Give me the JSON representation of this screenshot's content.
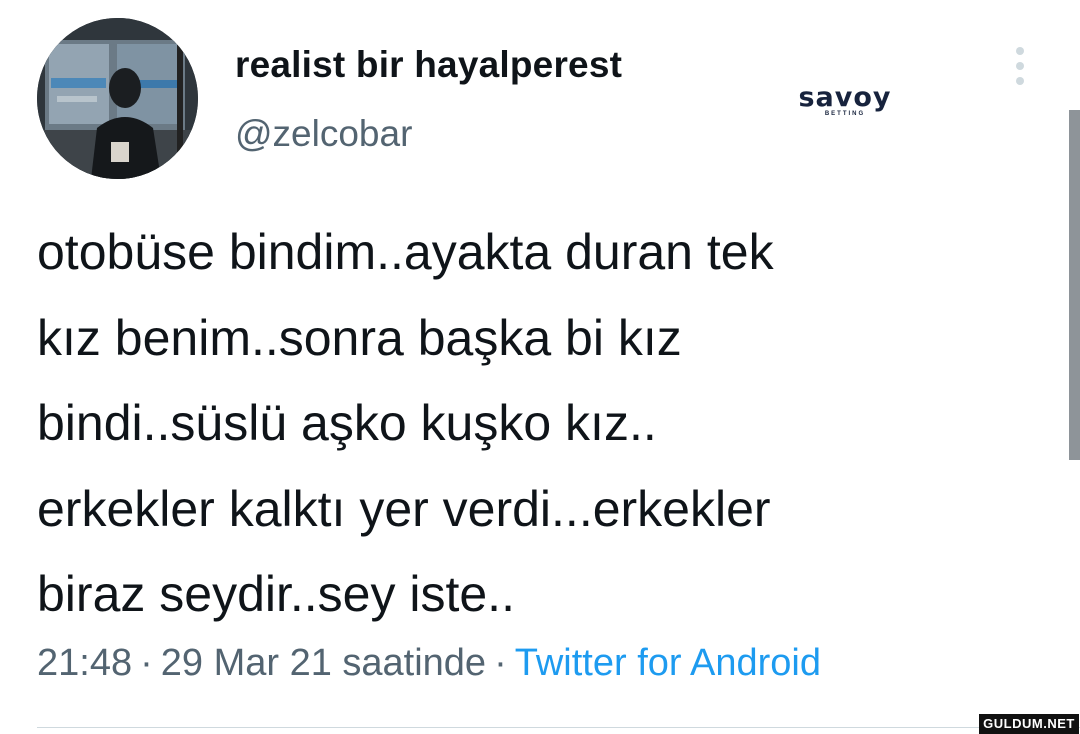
{
  "user": {
    "display_name": "realist bir hayalperest",
    "handle": "@zelcobar"
  },
  "logo": {
    "word": "savoy",
    "sub": "BETTING"
  },
  "tweet": {
    "lines": [
      "otobüse bindim..ayakta duran tek",
      "kız benim..sonra başka bi kız",
      "bindi..süslü aşko kuşko kız..",
      "erkekler kalktı yer verdi...erkekler",
      "biraz seydir..sey iste.."
    ]
  },
  "meta": {
    "time": "21:48",
    "separator": "·",
    "date": "29 Mar 21 saatinde",
    "source": "Twitter for Android"
  },
  "watermark": "GULDUM.NET",
  "colors": {
    "text": "#0f1419",
    "secondary": "#536471",
    "link": "#1d9bf0",
    "logo": "#17233d"
  },
  "icons": {
    "more": "vertical-ellipsis-icon"
  }
}
